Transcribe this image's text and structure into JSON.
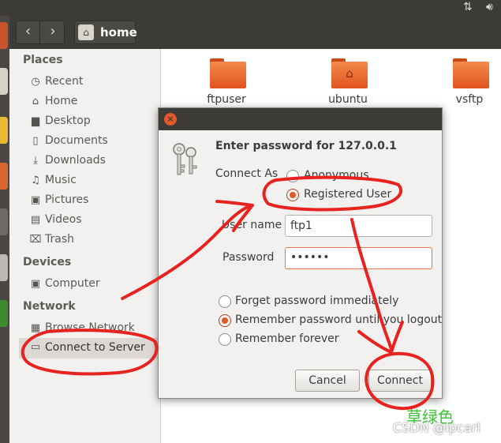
{
  "top_panel": {
    "icons": [
      "network-updown-icon",
      "volume-icon"
    ]
  },
  "toolbar": {
    "path": "home"
  },
  "sidebar": {
    "places_heading": "Places",
    "places": [
      {
        "label": "Recent",
        "icon": "clock-icon"
      },
      {
        "label": "Home",
        "icon": "home-icon"
      },
      {
        "label": "Desktop",
        "icon": "desktop-folder-icon"
      },
      {
        "label": "Documents",
        "icon": "document-icon"
      },
      {
        "label": "Downloads",
        "icon": "download-icon"
      },
      {
        "label": "Music",
        "icon": "music-note-icon"
      },
      {
        "label": "Pictures",
        "icon": "camera-icon"
      },
      {
        "label": "Videos",
        "icon": "film-icon"
      },
      {
        "label": "Trash",
        "icon": "trash-icon"
      }
    ],
    "devices_heading": "Devices",
    "devices": [
      {
        "label": "Computer",
        "icon": "drive-icon"
      }
    ],
    "network_heading": "Network",
    "network": [
      {
        "label": "Browse Network",
        "icon": "network-icon"
      },
      {
        "label": "Connect to Server",
        "icon": "server-icon"
      }
    ]
  },
  "files": [
    {
      "name": "ftpuser"
    },
    {
      "name": "ubuntu"
    },
    {
      "name": "vsftp"
    }
  ],
  "dialog": {
    "title": "Enter password for 127.0.0.1",
    "connect_as_label": "Connect As",
    "anonymous_label": "Anonymous",
    "registered_label": "Registered User",
    "username_label": "User name",
    "username_value": "ftp1",
    "password_label": "Password",
    "password_value": "••••••",
    "remember_options": [
      "Forget password immediately",
      "Remember password until you logout",
      "Remember forever"
    ],
    "cancel_label": "Cancel",
    "connect_label": "Connect"
  },
  "watermark": {
    "cn": "草绿色",
    "csdn": "CSDN @lpcarl"
  },
  "colors": {
    "accent": "#e05a25",
    "annotation": "#e8221f",
    "watermark_green": "#3ec236"
  }
}
